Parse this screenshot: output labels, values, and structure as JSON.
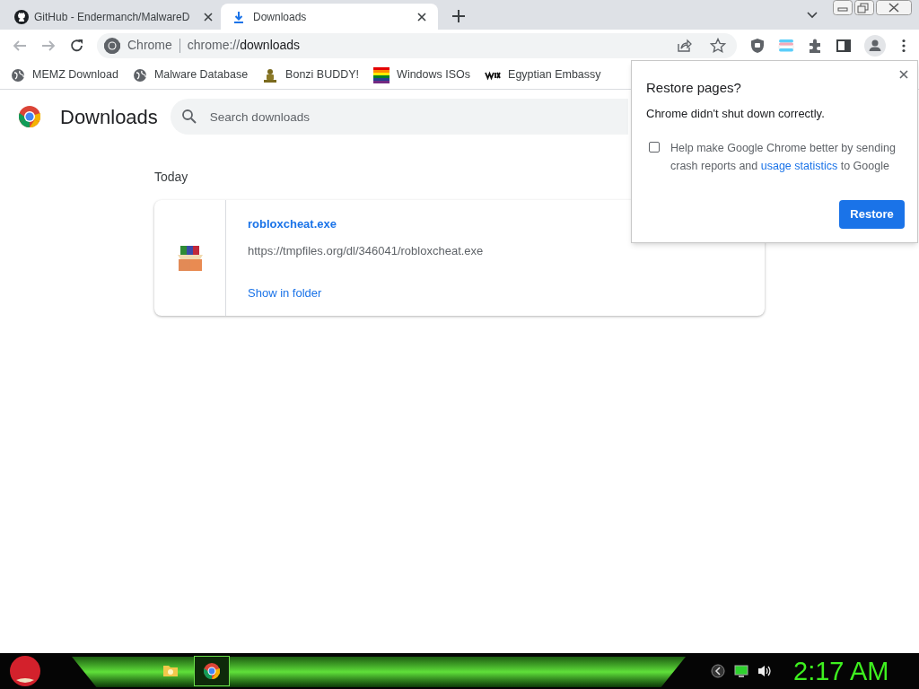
{
  "tabs": [
    {
      "title": "GitHub - Endermanch/MalwareD",
      "kind": "github",
      "selected": false
    },
    {
      "title": "Downloads",
      "kind": "download",
      "selected": true
    }
  ],
  "address_bar": {
    "site_label": "Chrome",
    "url_prefix": "chrome://",
    "url_rest": "downloads"
  },
  "bookmarks": [
    {
      "label": "MEMZ Download",
      "kind": "globe"
    },
    {
      "label": "Malware Database",
      "kind": "globe"
    },
    {
      "label": "Bonzi BUDDY!",
      "kind": "figure"
    },
    {
      "label": "Windows ISOs",
      "kind": "rainbow"
    },
    {
      "label": "Egyptian Embassy",
      "kind": "wix"
    }
  ],
  "page": {
    "title": "Downloads",
    "search": {
      "placeholder": "Search downloads"
    },
    "section": "Today",
    "downloads": [
      {
        "name": "robloxcheat.exe",
        "url": "https://tmpfiles.org/dl/346041/robloxcheat.exe",
        "action": "Show in folder"
      }
    ]
  },
  "dialog": {
    "title": "Restore pages?",
    "message": "Chrome didn't shut down correctly.",
    "checkbox": {
      "text_before": "Help make Google Chrome better by sending crash reports and ",
      "link": "usage statistics",
      "text_after": " to Google",
      "checked": false
    },
    "button": "Restore"
  },
  "taskbar": {
    "apps": [
      {
        "kind": "folder",
        "selected": false
      },
      {
        "kind": "chrome",
        "selected": true
      }
    ],
    "clock": "2:17 AM"
  }
}
